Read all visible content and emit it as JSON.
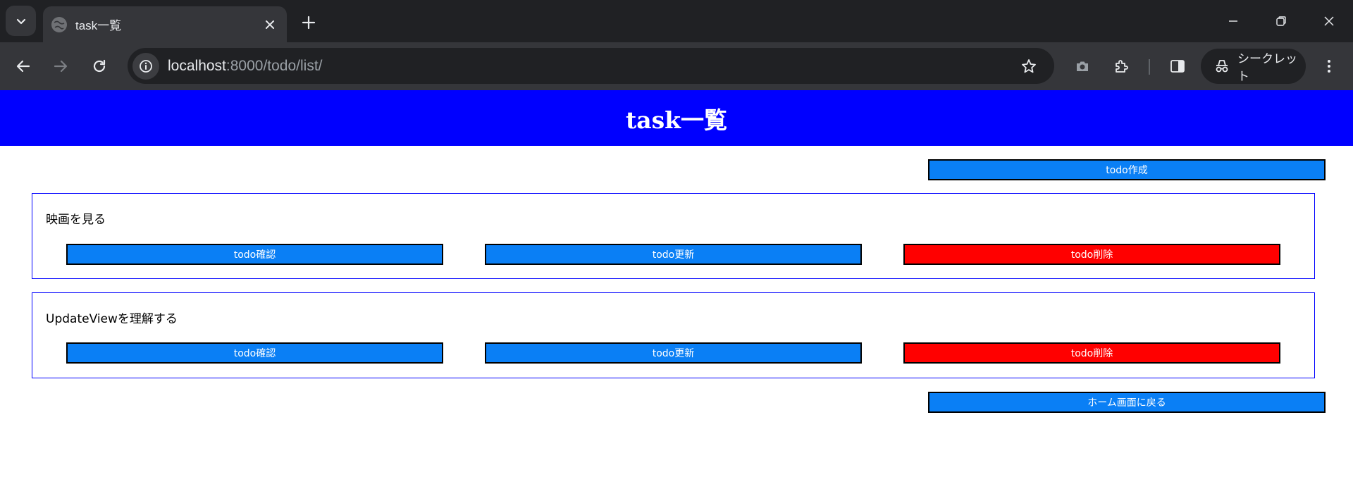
{
  "browser": {
    "tab_title": "task一覧",
    "url_host": "localhost",
    "url_path": ":8000/todo/list/",
    "incognito_label": "シークレット"
  },
  "page": {
    "header_title": "task一覧",
    "create_button": "todo作成",
    "home_button": "ホーム画面に戻る",
    "tasks": [
      {
        "title": "映画を見る",
        "detail_button": "todo確認",
        "update_button": "todo更新",
        "delete_button": "todo削除"
      },
      {
        "title": "UpdateViewを理解する",
        "detail_button": "todo確認",
        "update_button": "todo更新",
        "delete_button": "todo削除"
      }
    ]
  },
  "colors": {
    "header_bg": "#0000ff",
    "primary_button": "#0a7ff5",
    "danger_button": "#ff0000",
    "card_border": "#0000ff"
  }
}
